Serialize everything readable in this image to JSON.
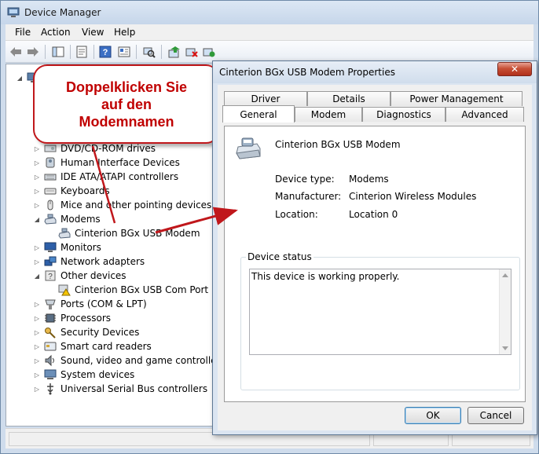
{
  "device_manager": {
    "title": "Device Manager",
    "menu": [
      "File",
      "Action",
      "View",
      "Help"
    ],
    "toolbar_icons": [
      "back-arrow-icon",
      "forward-arrow-icon",
      "console-tree-icon",
      "properties-sheet-icon",
      "help-icon",
      "details-pane-icon",
      "scan-hardware-icon",
      "update-driver-icon",
      "disable-device-icon",
      "uninstall-device-icon"
    ],
    "tree": [
      {
        "label": "DVD/CD-ROM drives",
        "icon": "dvd-drive-icon",
        "expander": "collapsed",
        "indent": 0
      },
      {
        "label": "Human Interface Devices",
        "icon": "hid-icon",
        "expander": "collapsed",
        "indent": 0
      },
      {
        "label": "IDE ATA/ATAPI controllers",
        "icon": "ide-controller-icon",
        "expander": "collapsed",
        "indent": 0
      },
      {
        "label": "Keyboards",
        "icon": "keyboard-icon",
        "expander": "collapsed",
        "indent": 0
      },
      {
        "label": "Mice and other pointing devices",
        "icon": "mouse-icon",
        "expander": "collapsed",
        "indent": 0
      },
      {
        "label": "Modems",
        "icon": "modem-icon",
        "expander": "expanded",
        "indent": 0
      },
      {
        "label": "Cinterion BGx USB Modem",
        "icon": "modem-icon",
        "expander": "none",
        "indent": 1
      },
      {
        "label": "Monitors",
        "icon": "monitor-icon",
        "expander": "collapsed",
        "indent": 0
      },
      {
        "label": "Network adapters",
        "icon": "network-adapter-icon",
        "expander": "collapsed",
        "indent": 0
      },
      {
        "label": "Other devices",
        "icon": "unknown-device-icon",
        "expander": "expanded",
        "indent": 0
      },
      {
        "label": "Cinterion BGx USB Com Port",
        "icon": "warning-device-icon",
        "expander": "none",
        "indent": 1
      },
      {
        "label": "Ports (COM & LPT)",
        "icon": "port-icon",
        "expander": "collapsed",
        "indent": 0
      },
      {
        "label": "Processors",
        "icon": "processor-icon",
        "expander": "collapsed",
        "indent": 0
      },
      {
        "label": "Security Devices",
        "icon": "security-key-icon",
        "expander": "collapsed",
        "indent": 0
      },
      {
        "label": "Smart card readers",
        "icon": "smart-card-icon",
        "expander": "collapsed",
        "indent": 0
      },
      {
        "label": "Sound, video and game controllers",
        "icon": "sound-icon",
        "expander": "collapsed",
        "indent": 0
      },
      {
        "label": "System devices",
        "icon": "system-devices-icon",
        "expander": "collapsed",
        "indent": 0
      },
      {
        "label": "Universal Serial Bus controllers",
        "icon": "usb-icon",
        "expander": "collapsed",
        "indent": 0
      }
    ]
  },
  "callout": {
    "text": "Doppelklicken Sie\nauf den\nModemnamen",
    "color": "#c00000"
  },
  "properties_dialog": {
    "title": "Cinterion BGx USB Modem Properties",
    "close_label": "✕",
    "tabs_back": [
      "Driver",
      "Details",
      "Power Management"
    ],
    "tabs_front": [
      "General",
      "Modem",
      "Diagnostics",
      "Advanced"
    ],
    "active_tab": "General",
    "device_name": "Cinterion BGx USB Modem",
    "fields": [
      {
        "label": "Device type:",
        "value": "Modems"
      },
      {
        "label": "Manufacturer:",
        "value": "Cinterion Wireless Modules"
      },
      {
        "label": "Location:",
        "value": "Location 0"
      }
    ],
    "device_status_label": "Device status",
    "device_status_text": "This device is working properly.",
    "ok_label": "OK",
    "cancel_label": "Cancel"
  }
}
